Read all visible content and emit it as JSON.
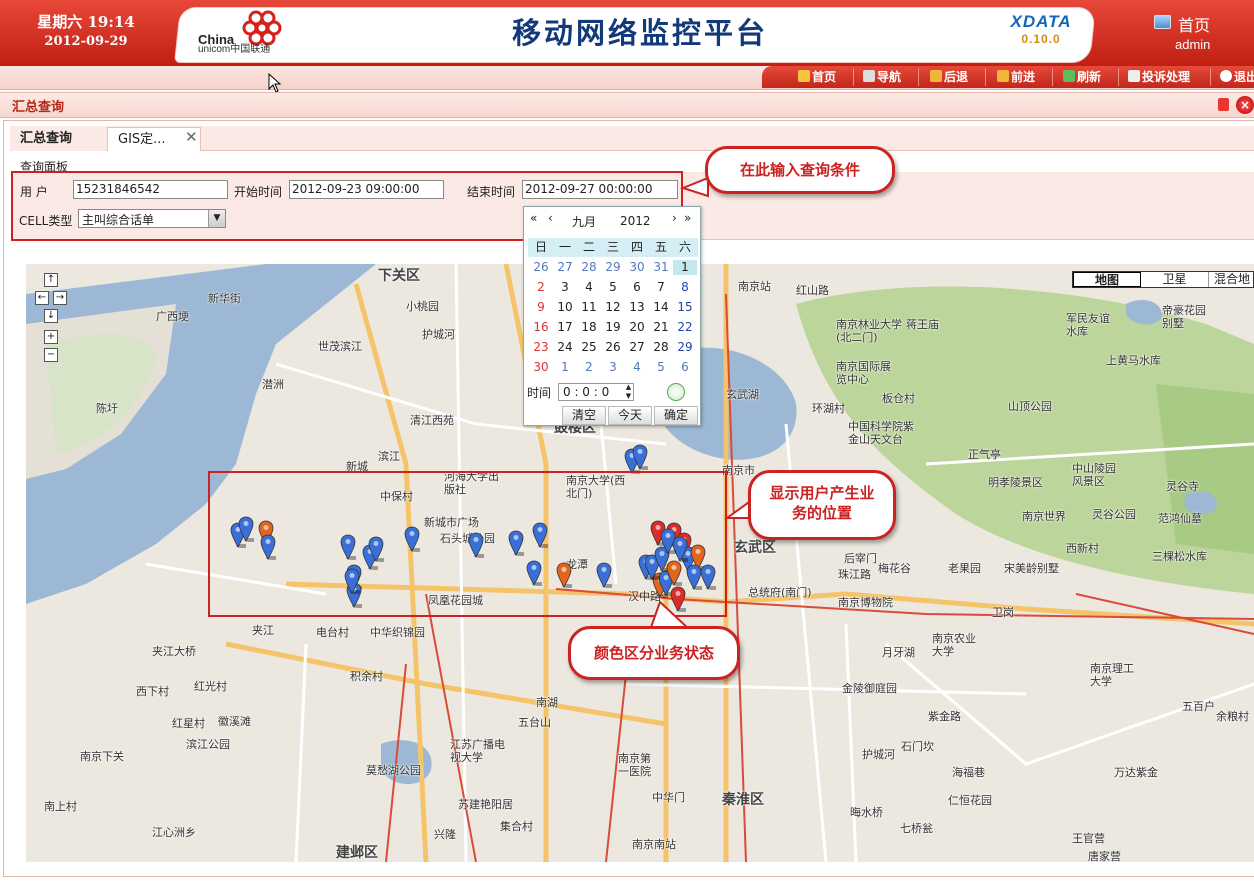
{
  "header": {
    "weekday_time": "星期六  19:14",
    "date": "2012-09-29",
    "logo_en": "China",
    "logo_en2": "unicom中国联通",
    "title": "移动网络监控平台",
    "brand": "XDATA",
    "version": "0.10.0",
    "home_label": "首页",
    "username": "admin"
  },
  "toolbar": {
    "items": [
      {
        "label": "首页",
        "icon": "home-icon"
      },
      {
        "label": "导航",
        "icon": "sitemap-icon"
      },
      {
        "label": "后退",
        "icon": "back-arrow-icon"
      },
      {
        "label": "前进",
        "icon": "forward-arrow-icon"
      },
      {
        "label": "刷新",
        "icon": "refresh-icon"
      },
      {
        "label": "投诉处理",
        "icon": "complaint-icon"
      },
      {
        "label": "退出",
        "icon": "exit-icon"
      }
    ]
  },
  "panel": {
    "title": "汇总查询"
  },
  "tabs": [
    {
      "label": "汇总查询",
      "active": false
    },
    {
      "label": "GIS定...",
      "active": true
    }
  ],
  "query": {
    "panel_label": "查询面板",
    "user_label": "用     户",
    "user_value": "15231846542",
    "start_label": "开始时间",
    "start_value": "2012-09-23 09:00:00",
    "end_label": "结束时间",
    "end_value": "2012-09-27 00:00:00",
    "cell_label": "CELL类型",
    "cell_value": "主叫综合话单"
  },
  "calendar": {
    "month": "九月",
    "year": "2012",
    "weekdays": [
      "日",
      "一",
      "二",
      "三",
      "四",
      "五",
      "六"
    ],
    "weeks": [
      [
        "26",
        "27",
        "28",
        "29",
        "30",
        "31",
        "1"
      ],
      [
        "2",
        "3",
        "4",
        "5",
        "6",
        "7",
        "8"
      ],
      [
        "9",
        "10",
        "11",
        "12",
        "13",
        "14",
        "15"
      ],
      [
        "16",
        "17",
        "18",
        "19",
        "20",
        "21",
        "22"
      ],
      [
        "23",
        "24",
        "25",
        "26",
        "27",
        "28",
        "29"
      ],
      [
        "30",
        "1",
        "2",
        "3",
        "4",
        "5",
        "6"
      ]
    ],
    "time_label": "时间",
    "time_value": "0 : 0 : 0",
    "clear": "清空",
    "today": "今天",
    "ok": "确定"
  },
  "map": {
    "types": [
      "地图",
      "卫星",
      "混合地"
    ],
    "labels": [
      "下关区",
      "新华街",
      "广西埂",
      "小桃园",
      "护城河",
      "世茂滨江",
      "新城",
      "滨江",
      "潜洲",
      "陈圩",
      "清江西苑",
      "鼓楼区",
      "玄武区",
      "秦淮区",
      "建邺区",
      "南京站",
      "红山路",
      "南京林业大学(北二门)",
      "蒋王庙",
      "军民友谊水库",
      "帝豪花园别墅",
      "上黄马水库",
      "南京国际展览中心",
      "玄武湖",
      "环湖村",
      "板仓村",
      "中国科学院紫金山天文台",
      "山顶公园",
      "正气亭",
      "中山陵园风景区",
      "明孝陵景区",
      "灵谷寺",
      "南京世界",
      "灵谷公园",
      "范鸿仙墓",
      "西新村",
      "三棵松水库",
      "南京市",
      "中保村",
      "新城市广场",
      "石头城公园",
      "南京大学(西北门)",
      "河海大学出版社",
      "龙潭",
      "凤凰花园城",
      "汉中路",
      "总统府(南门)",
      "后宰门",
      "梅花谷",
      "老果园",
      "宋美龄别墅",
      "南京博物院",
      "珠江路",
      "卫岗",
      "南京农业大学",
      "月牙湖",
      "南京理工大学",
      "金陵御庭园",
      "紫金路",
      "五百户",
      "余粮村",
      "夹江",
      "电台村",
      "中华织锦园",
      "夹江大桥",
      "西下村",
      "红光村",
      "积余村",
      "南湖",
      "红星村",
      "徽溪滩",
      "滨江公园",
      "南京下关",
      "江苏广播电视大学",
      "莫愁湖公园",
      "南京第一医院",
      "五台山",
      "护城河",
      "石门坎",
      "海福巷",
      "仁恒花园",
      "万达紫金",
      "南上村",
      "江心洲乡",
      "苏建艳阳居",
      "集合村",
      "兴隆",
      "南京南站",
      "中华门",
      "晦水桥",
      "七桥瓮",
      "王官营",
      "唐家营"
    ],
    "pins": [
      {
        "color": "#3a6fd8"
      },
      {
        "color": "#3a6fd8"
      },
      {
        "color": "#e0651f"
      },
      {
        "color": "#3a6fd8"
      },
      {
        "color": "#3a6fd8"
      },
      {
        "color": "#3a6fd8"
      },
      {
        "color": "#3a6fd8"
      },
      {
        "color": "#3a6fd8"
      },
      {
        "color": "#3a6fd8"
      },
      {
        "color": "#3a6fd8"
      },
      {
        "color": "#3a6fd8"
      },
      {
        "color": "#e0651f"
      },
      {
        "color": "#3a6fd8"
      },
      {
        "color": "#3a6fd8"
      },
      {
        "color": "#3a6fd8"
      },
      {
        "color": "#d92c2c"
      },
      {
        "color": "#d92c2c"
      },
      {
        "color": "#e0651f"
      },
      {
        "color": "#3a6fd8"
      },
      {
        "color": "#d92c2c"
      },
      {
        "color": "#3a6fd8"
      },
      {
        "color": "#e0651f"
      },
      {
        "color": "#3a6fd8"
      },
      {
        "color": "#3a6fd8"
      },
      {
        "color": "#d92c2c"
      }
    ]
  },
  "callouts": {
    "query": "在此输入查询条件",
    "location_line1": "显示用户产生业",
    "location_line2": "务的位置",
    "status": "颜色区分业务状态"
  },
  "colors": {
    "header_red": "#c8291c",
    "callout_red": "#cc2222",
    "water": "#9ab5d1",
    "park": "#b7d08f"
  }
}
